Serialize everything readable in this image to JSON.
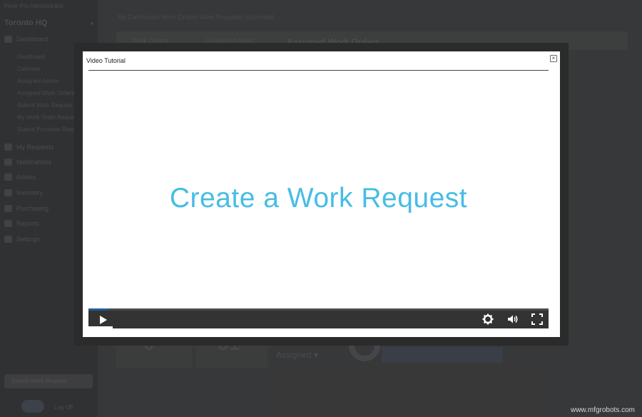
{
  "sidebar": {
    "org_sub": "Fiixer Pro Administrator",
    "location": "Toronto HQ",
    "nav": [
      {
        "label": "Dashboard"
      },
      {
        "label": "My Requests"
      },
      {
        "label": "Notifications"
      },
      {
        "label": "Assets"
      },
      {
        "label": "Inventory"
      },
      {
        "label": "Purchasing"
      },
      {
        "label": "Reports"
      },
      {
        "label": "Settings"
      }
    ],
    "sub_items": [
      {
        "label": "Dashboard"
      },
      {
        "label": "Calendar"
      },
      {
        "label": "Assigned Assets"
      },
      {
        "label": "Assigned Work Orders"
      },
      {
        "label": "Submit Work Request"
      },
      {
        "label": "My Work Order Requests"
      },
      {
        "label": "Submit Purchase Request"
      }
    ],
    "bottom_button": "Submit Work Request",
    "logout": "Log Off"
  },
  "main": {
    "breadcrumb": "My Dashboard  Work Orders  Work Requests  Submitted",
    "tabs": [
      "Work Orders",
      "Scheduled Maint."
    ],
    "title": "Assigned Work Orders",
    "stats": [
      "0",
      "31"
    ],
    "select_label": "Assigned"
  },
  "modal": {
    "title": "Video Tutorial",
    "close_glyph": "×",
    "video_headline": "Create a Work Request",
    "progress_fraction": 0.043
  },
  "colors": {
    "accent": "#46bde5",
    "progress": "#1f5f9b"
  },
  "watermark": "www.mfgrobots.com"
}
